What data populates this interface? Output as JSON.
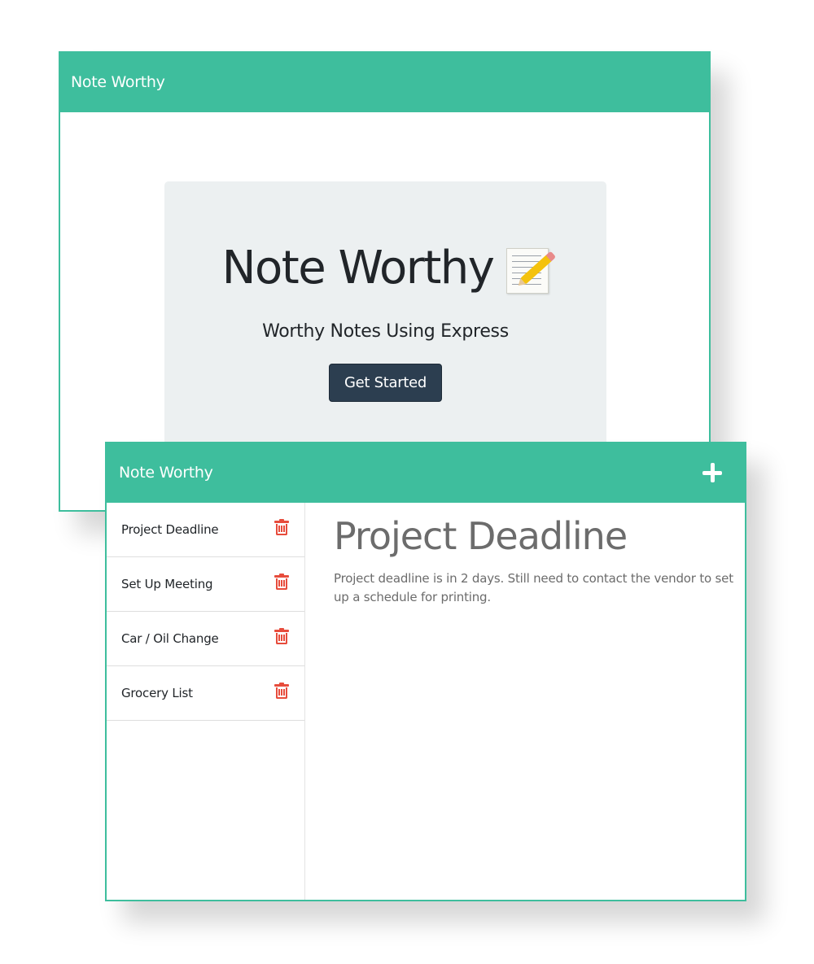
{
  "landing": {
    "brand": "Note Worthy",
    "title": "Note Worthy",
    "title_icon": "memo-icon",
    "subtitle": "Worthy Notes Using Express",
    "get_started_label": "Get Started"
  },
  "notes_app": {
    "brand": "Note Worthy",
    "add_icon": "plus-icon",
    "notes": [
      {
        "title": "Project Deadline",
        "icon": "trash-icon"
      },
      {
        "title": "Set Up Meeting",
        "icon": "trash-icon"
      },
      {
        "title": "Car / Oil Change",
        "icon": "trash-icon"
      },
      {
        "title": "Grocery List",
        "icon": "trash-icon"
      }
    ],
    "active_note": {
      "title": "Project Deadline",
      "text": "Project deadline is in 2 days. Still need to contact the vendor to set up a schedule for printing."
    }
  },
  "colors": {
    "navbar": "#3ebe9d",
    "jumbotron": "#ecf0f1",
    "button": "#2c3e50",
    "trash": "#e74c3c",
    "note_text": "#6c6c6c"
  }
}
